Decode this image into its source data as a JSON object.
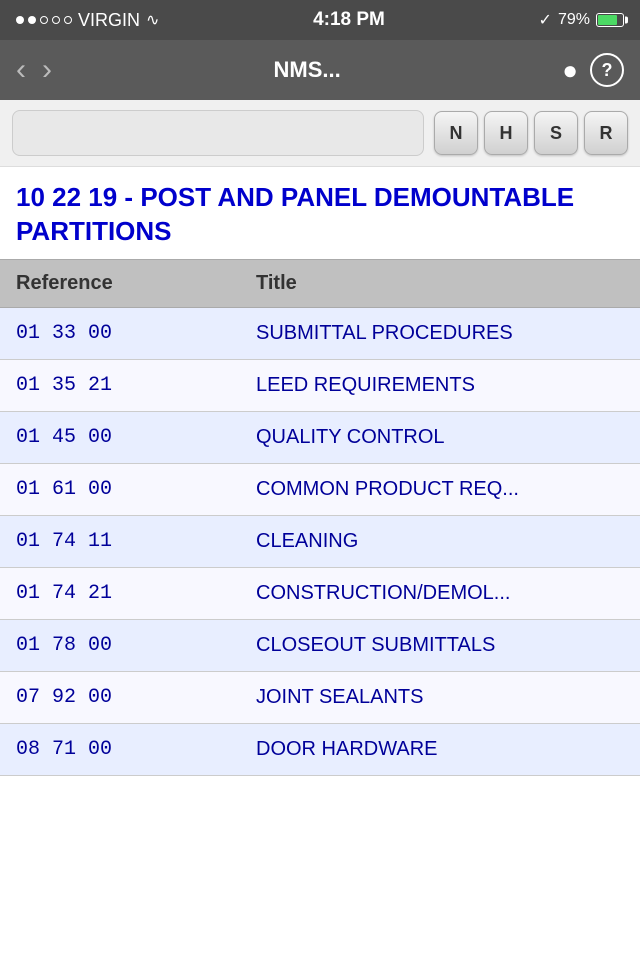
{
  "statusBar": {
    "carrier": "VIRGIN",
    "time": "4:18 PM",
    "battery": "79%"
  },
  "navBar": {
    "title": "NMS...",
    "searchLabel": "🔍",
    "helpLabel": "?"
  },
  "filterButtons": [
    {
      "label": "N",
      "key": "n-filter"
    },
    {
      "label": "H",
      "key": "h-filter"
    },
    {
      "label": "S",
      "key": "s-filter"
    },
    {
      "label": "R",
      "key": "r-filter"
    }
  ],
  "pageTitle": "10 22 19 - POST AND PANEL DEMOUNTABLE PARTITIONS",
  "table": {
    "headers": [
      "Reference",
      "Title"
    ],
    "rows": [
      {
        "ref": "01  33  00",
        "title": "SUBMITTAL PROCEDURES"
      },
      {
        "ref": "01  35  21",
        "title": "LEED  REQUIREMENTS"
      },
      {
        "ref": "01  45  00",
        "title": "QUALITY  CONTROL"
      },
      {
        "ref": "01  61  00",
        "title": "COMMON PRODUCT REQ..."
      },
      {
        "ref": "01  74  11",
        "title": "CLEANING"
      },
      {
        "ref": "01  74  21",
        "title": "CONSTRUCTION/DEMOL..."
      },
      {
        "ref": "01  78  00",
        "title": "CLOSEOUT SUBMITTALS"
      },
      {
        "ref": "07  92  00",
        "title": "JOINT  SEALANTS"
      },
      {
        "ref": "08  71  00",
        "title": "DOOR HARDWARE"
      }
    ]
  }
}
